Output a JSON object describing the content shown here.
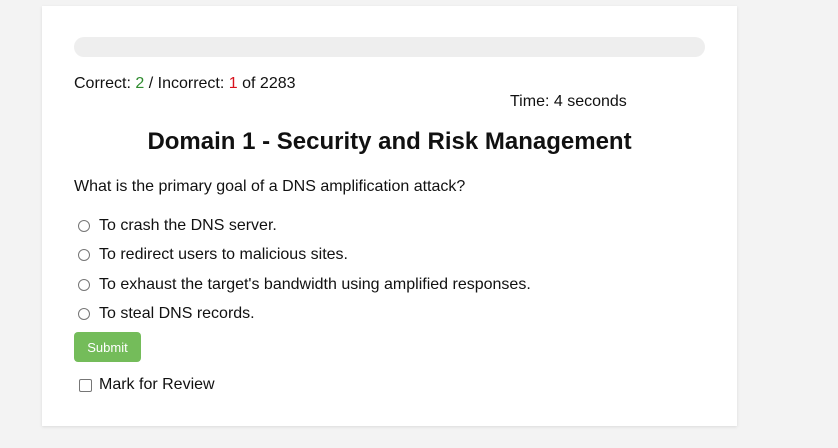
{
  "progress": {
    "fraction": 0
  },
  "score": {
    "correct_label": "Correct:",
    "correct_value": "2",
    "separator": "/",
    "incorrect_label": "Incorrect:",
    "incorrect_value": "1",
    "of_text": "of 2283"
  },
  "timer": {
    "label": "Time:",
    "value": "4 seconds"
  },
  "domain_title": "Domain 1 - Security and Risk Management",
  "question": "What is the primary goal of a DNS amplification attack?",
  "options": [
    "To crash the DNS server.",
    "To redirect users to malicious sites.",
    "To exhaust the target's bandwidth using amplified responses.",
    "To steal DNS records."
  ],
  "submit_label": "Submit",
  "review_label": "Mark for Review",
  "colors": {
    "correct": "#2e8b2e",
    "incorrect": "#d8121d",
    "submit": "#74bc5a",
    "progress_track": "#eeeeee"
  }
}
